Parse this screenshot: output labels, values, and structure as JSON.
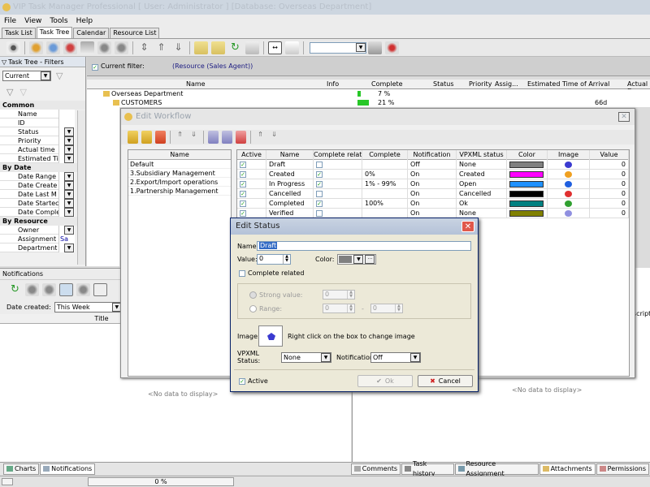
{
  "app": {
    "title": "VIP Task Manager Professional [ User: Administrator ] [Database: Overseas Department]"
  },
  "menu": [
    "File",
    "View",
    "Tools",
    "Help"
  ],
  "tabs": [
    "Task List",
    "Task Tree",
    "Calendar",
    "Resource List"
  ],
  "left_pane": {
    "title": "Task Tree - Filters",
    "filter_select": "Current",
    "groups": [
      {
        "name": "Common",
        "fields": [
          "Name",
          "ID",
          "Status",
          "Priority",
          "Actual time",
          "Estimated Ti"
        ]
      },
      {
        "name": "By Date",
        "fields": [
          "Date Range",
          "Date Create",
          "Date Last M",
          "Date Startec",
          "Date Comple"
        ]
      },
      {
        "name": "By Resource",
        "fields": [
          "Owner",
          "Assignment",
          "Department"
        ]
      }
    ],
    "assignment_value": "Sa"
  },
  "filter_bar": {
    "label": "Current filter:",
    "value": "(Resource (Sales Agent))"
  },
  "grid": {
    "columns": [
      "Name",
      "Info",
      "Complete",
      "Status",
      "Priority",
      "Assig...",
      "Estimated Time of Arrival",
      "Actual D"
    ],
    "rows": [
      {
        "name": "Overseas Department",
        "complete": "7 %",
        "eta": ""
      },
      {
        "name": "CUSTOMERS",
        "complete": "21 %",
        "eta": "66d"
      }
    ]
  },
  "edit_workflow": {
    "title": "Edit Workflow",
    "list_header": "Name",
    "list_items": [
      "Default",
      "3.Subsidiary Management",
      "2.Export/Import operations",
      "1.Partnership Management"
    ],
    "columns": [
      "Active",
      "Name",
      "Complete related",
      "Complete",
      "Notification",
      "VPXML status",
      "Color",
      "Image",
      "Value"
    ],
    "rows": [
      {
        "name": "Draft",
        "complete_related": false,
        "complete": "",
        "notification": "Off",
        "vpxml": "None",
        "color": "#808080",
        "value": "0",
        "image_color": "#3a3ad0"
      },
      {
        "name": "Created",
        "complete_related": true,
        "complete": "0%",
        "notification": "On",
        "vpxml": "Created",
        "color": "#ff00ff",
        "value": "0",
        "image_color": "#f0a020"
      },
      {
        "name": "In Progress",
        "complete_related": true,
        "complete": "1% - 99%",
        "notification": "On",
        "vpxml": "Open",
        "color": "#1e90ff",
        "value": "0",
        "image_color": "#2060e0"
      },
      {
        "name": "Cancelled",
        "complete_related": false,
        "complete": "",
        "notification": "On",
        "vpxml": "Cancelled",
        "color": "#000000",
        "value": "0",
        "image_color": "#e03030"
      },
      {
        "name": "Completed",
        "complete_related": true,
        "complete": "100%",
        "notification": "On",
        "vpxml": "Ok",
        "color": "#008080",
        "value": "0",
        "image_color": "#30a030"
      },
      {
        "name": "Verified",
        "complete_related": false,
        "complete": "",
        "notification": "On",
        "vpxml": "None",
        "color": "#808000",
        "value": "0",
        "image_color": "#9090e0"
      }
    ]
  },
  "edit_status": {
    "title": "Edit Status",
    "name_label": "Name",
    "name_value": "Draft",
    "value_label": "Value:",
    "value": "0",
    "color_label": "Color:",
    "complete_related_label": "Complete related",
    "strong_value_label": "Strong value:",
    "range_label": "Range:",
    "strong_value": "0",
    "range_from": "0",
    "range_to": "0",
    "range_dash": "-",
    "image_label": "Image:",
    "image_hint": "Right click on the box to  change image",
    "vpxml_label": "VPXML Status:",
    "vpxml_value": "None",
    "notification_label": "Notification:",
    "notification_value": "Off",
    "active_label": "Active",
    "ok_label": "Ok",
    "cancel_label": "Cancel"
  },
  "notifications": {
    "title": "Notifications",
    "date_label": "Date created:",
    "date_value": "This Week",
    "column_title": "Title",
    "no_data": "<No data to display>"
  },
  "right_bottom": {
    "no_data": "<No data to display>",
    "col_partial": "scriptio"
  },
  "bottom_tabs_left": [
    "Charts",
    "Notifications"
  ],
  "bottom_tabs_right": [
    "Comments",
    "Task history",
    "Resource Assignment",
    "Attachments",
    "Permissions"
  ],
  "status": {
    "progress": "0 %"
  }
}
